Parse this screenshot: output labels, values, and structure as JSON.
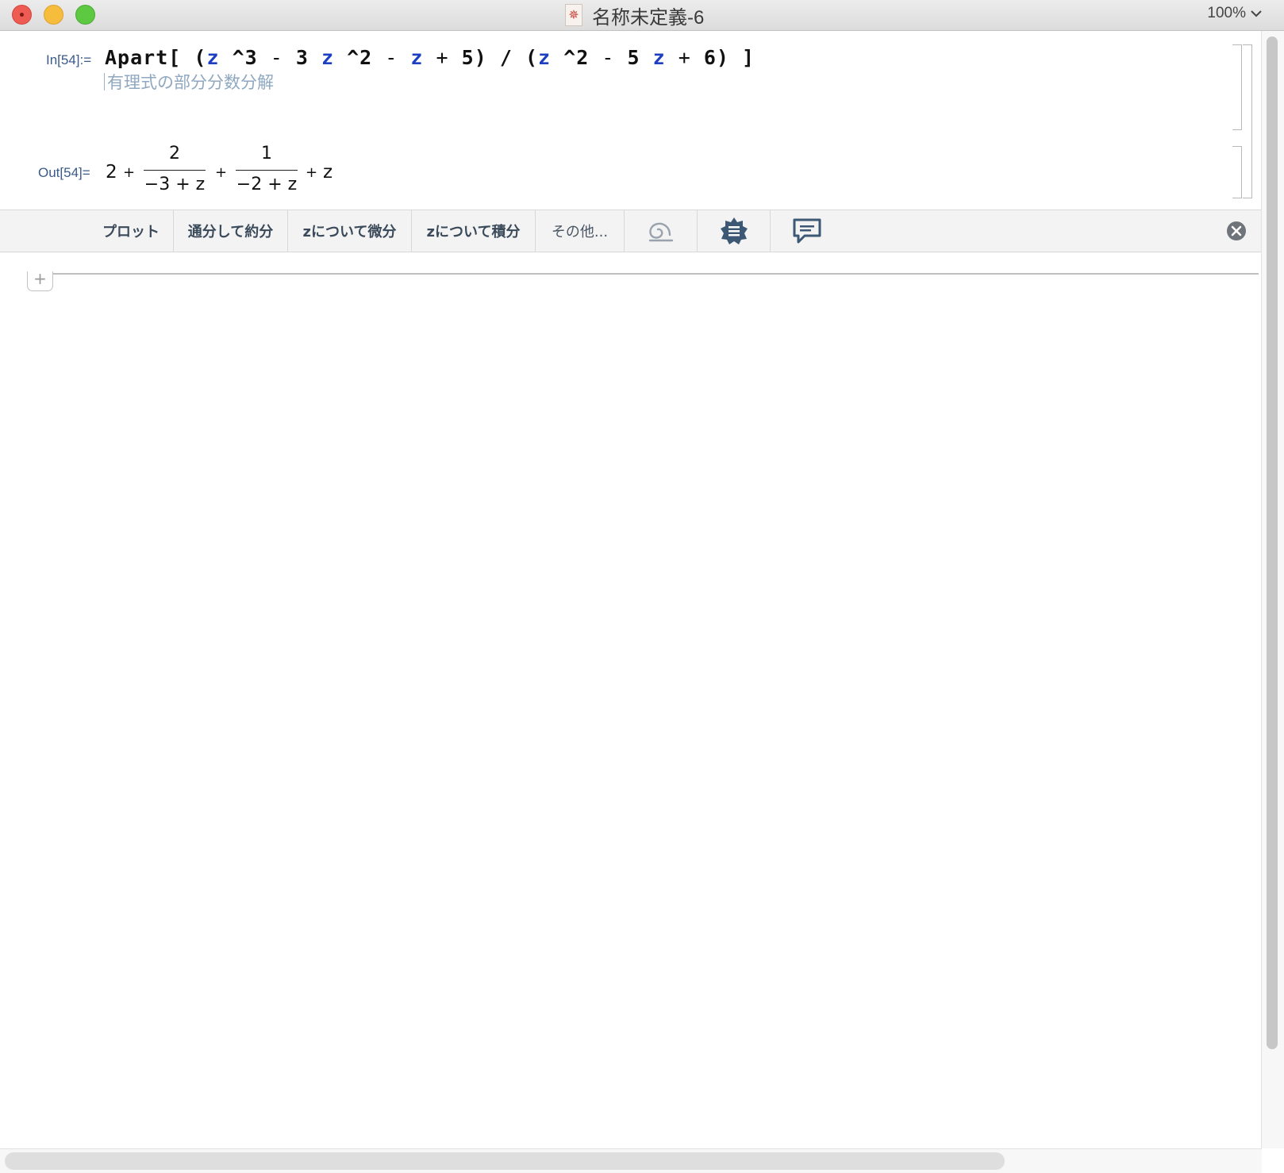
{
  "window": {
    "title": "名称未定義-6",
    "zoom": "100%"
  },
  "input_cell": {
    "label": "In[54]:=",
    "code": {
      "fn": "Apart",
      "open": "[",
      "p1": "(",
      "z": "z",
      "pow3": "^3",
      "minus": "-",
      "three": "3",
      "pow2": "^2",
      "plus": "+",
      "five": "5",
      "close_paren": ")",
      "slash": "/",
      "two": "2",
      "six": "6",
      "close": "]"
    },
    "hint": "有理式の部分分数分解"
  },
  "output_cell": {
    "label": "Out[54]=",
    "terms": {
      "t1": "2",
      "plus": "+",
      "f1_num": "2",
      "f1_den": "−3 + z",
      "f2_num": "1",
      "f2_den": "−2 + z",
      "last": "z"
    }
  },
  "suggestions": {
    "items": [
      "プロット",
      "通分して約分",
      "zについて微分",
      "zについて積分",
      "その他..."
    ]
  },
  "colors": {
    "variable": "#1c3fc2",
    "label": "#3a5a8a",
    "hint": "#8fa8c0",
    "suggest_icon": "#3d5874"
  }
}
